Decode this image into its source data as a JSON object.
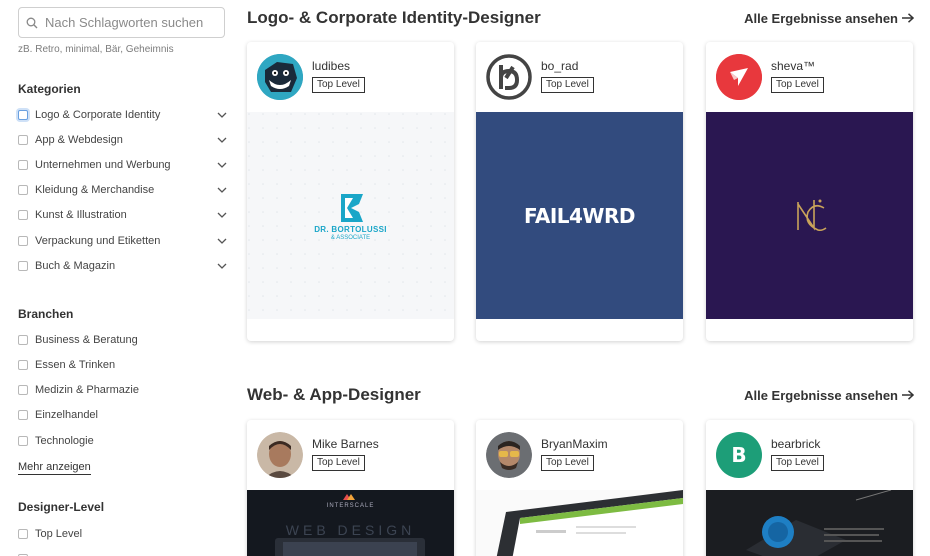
{
  "search": {
    "placeholder": "Nach Schlagworten suchen",
    "hint": "zB. Retro, minimal, Bär, Geheimnis"
  },
  "sidebar": {
    "kategorien_title": "Kategorien",
    "kategorien": [
      "Logo & Corporate Identity",
      "App & Webdesign",
      "Unternehmen und Werbung",
      "Kleidung & Merchandise",
      "Kunst & Illustration",
      "Verpackung und Etiketten",
      "Buch & Magazin"
    ],
    "branchen_title": "Branchen",
    "branchen": [
      "Business & Beratung",
      "Essen & Trinken",
      "Medizin & Pharmazie",
      "Einzelhandel",
      "Technologie"
    ],
    "more_label": "Mehr anzeigen",
    "level_title": "Designer-Level",
    "levels": [
      "Top Level"
    ]
  },
  "sections": [
    {
      "title": "Logo- & Corporate Identity-Designer",
      "see_all": "Alle Ergebnisse ansehen",
      "cards": [
        {
          "name": "ludibes",
          "badge": "Top Level",
          "logo_text_1": "DR. BORTOLUSSI",
          "logo_text_2": "& ASSOCIATE",
          "bg": "#f7f8fa"
        },
        {
          "name": "bo_rad",
          "badge": "Top Level",
          "logo_text": "FAIL4WRD",
          "bg": "#324b7e"
        },
        {
          "name": "sheva™",
          "badge": "Top Level",
          "bg": "#2a1751"
        }
      ]
    },
    {
      "title": "Web- & App-Designer",
      "see_all": "Alle Ergebnisse ansehen",
      "cards": [
        {
          "name": "Mike Barnes",
          "badge": "Top Level",
          "img_text_1": "INTERSCALE",
          "img_text_2": "WEB DESIGN"
        },
        {
          "name": "BryanMaxim",
          "badge": "Top Level"
        },
        {
          "name": "bearbrick",
          "badge": "Top Level",
          "avatar_letter": "B"
        }
      ]
    }
  ],
  "colors": {
    "accent_focus": "#6aa0e0",
    "bearbrick_green": "#1d9e78",
    "sheva_red": "#e8383d"
  }
}
